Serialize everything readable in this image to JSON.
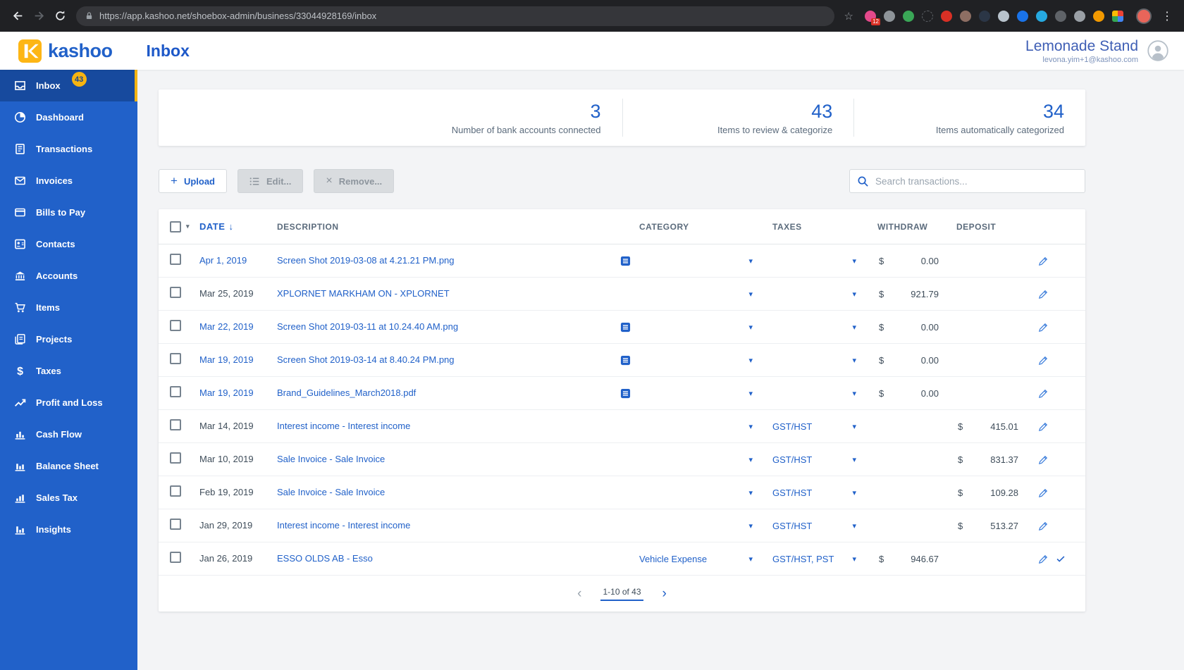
{
  "browser": {
    "url": "https://app.kashoo.net/shoebox-admin/business/33044928169/inbox",
    "extensions": [
      {
        "name": "extension-icon",
        "color": "#e4498b",
        "badge": "12"
      },
      {
        "name": "camera-extension-icon",
        "color": "#8e9499"
      },
      {
        "name": "extension-icon",
        "color": "#3aa757"
      },
      {
        "name": "extension-icon",
        "color": "#5f6368",
        "hollow": true
      },
      {
        "name": "extension-icon",
        "color": "#d93025"
      },
      {
        "name": "extension-icon",
        "color": "#8d6e63"
      },
      {
        "name": "extension-icon",
        "color": "#2b3646"
      },
      {
        "name": "extension-icon",
        "color": "#b8c3cc"
      },
      {
        "name": "extension-icon",
        "color": "#1a73e8"
      },
      {
        "name": "extension-icon",
        "color": "#26a9e0"
      },
      {
        "name": "extension-icon",
        "color": "#5f6368"
      },
      {
        "name": "extension-icon",
        "color": "#9aa0a6"
      },
      {
        "name": "extension-icon",
        "color": "#f29900"
      },
      {
        "name": "google-apps-grid-icon",
        "grid": true
      }
    ]
  },
  "icons": {
    "star": "☆",
    "browser_menu": "⋮",
    "caret": "▾",
    "select_caret": "▾",
    "sort_desc": "↓",
    "plus": "+",
    "close": "×",
    "pager_prev": "‹",
    "pager_next": "›"
  },
  "colors": {
    "accent_blue": "#2161c9",
    "sidebar_blue": "#2161c9",
    "sidebar_active_blue": "#174a9e",
    "brand_yellow": "#f6b411",
    "text_dark": "#3f4d5a",
    "text_muted": "#5b6b7c"
  },
  "header": {
    "logo_text": "kashoo",
    "page_title": "Inbox",
    "business_name": "Lemonade Stand",
    "user_email": "levona.yim+1@kashoo.com"
  },
  "sidebar": {
    "items": [
      {
        "label": "Inbox",
        "icon": "inbox-icon",
        "badge": "43",
        "active": true
      },
      {
        "label": "Dashboard",
        "icon": "dashboard-icon"
      },
      {
        "label": "Transactions",
        "icon": "transactions-icon"
      },
      {
        "label": "Invoices",
        "icon": "invoices-icon"
      },
      {
        "label": "Bills to Pay",
        "icon": "bills-to-pay-icon"
      },
      {
        "label": "Contacts",
        "icon": "contacts-icon"
      },
      {
        "label": "Accounts",
        "icon": "accounts-icon"
      },
      {
        "label": "Items",
        "icon": "items-icon"
      },
      {
        "label": "Projects",
        "icon": "projects-icon"
      },
      {
        "label": "Taxes",
        "icon": "taxes-icon"
      },
      {
        "label": "Profit and Loss",
        "icon": "profit-and-loss-icon"
      },
      {
        "label": "Cash Flow",
        "icon": "cash-flow-icon"
      },
      {
        "label": "Balance Sheet",
        "icon": "balance-sheet-icon"
      },
      {
        "label": "Sales Tax",
        "icon": "sales-tax-icon"
      },
      {
        "label": "Insights",
        "icon": "insights-icon"
      }
    ]
  },
  "stats": [
    {
      "value": "3",
      "label": "Number of bank accounts connected"
    },
    {
      "value": "43",
      "label": "Items to review & categorize"
    },
    {
      "value": "34",
      "label": "Items automatically categorized"
    }
  ],
  "toolbar": {
    "upload_label": "Upload",
    "edit_label": "Edit...",
    "remove_label": "Remove...",
    "search_placeholder": "Search transactions..."
  },
  "table": {
    "columns": [
      {
        "label": "DATE",
        "sorted": "desc"
      },
      {
        "label": "DESCRIPTION"
      },
      {
        "label": "CATEGORY"
      },
      {
        "label": "TAXES"
      },
      {
        "label": "WITHDRAW"
      },
      {
        "label": "DEPOSIT"
      }
    ],
    "currency_symbol": "$",
    "rows": [
      {
        "date": "Apr 1, 2019",
        "unread": true,
        "description": "Screen Shot 2019-03-08 at 4.21.21 PM.png",
        "attachment": true,
        "category": "",
        "taxes": "",
        "withdraw": "0.00",
        "deposit": "",
        "confirmed": false
      },
      {
        "date": "Mar 25, 2019",
        "unread": false,
        "description": "XPLORNET MARKHAM ON - XPLORNET",
        "attachment": false,
        "category": "",
        "taxes": "",
        "withdraw": "921.79",
        "deposit": "",
        "confirmed": false
      },
      {
        "date": "Mar 22, 2019",
        "unread": true,
        "description": "Screen Shot 2019-03-11 at 10.24.40 AM.png",
        "attachment": true,
        "category": "",
        "taxes": "",
        "withdraw": "0.00",
        "deposit": "",
        "confirmed": false
      },
      {
        "date": "Mar 19, 2019",
        "unread": true,
        "description": "Screen Shot 2019-03-14 at 8.40.24 PM.png",
        "attachment": true,
        "category": "",
        "taxes": "",
        "withdraw": "0.00",
        "deposit": "",
        "confirmed": false
      },
      {
        "date": "Mar 19, 2019",
        "unread": true,
        "description": "Brand_Guidelines_March2018.pdf",
        "attachment": true,
        "category": "",
        "taxes": "",
        "withdraw": "0.00",
        "deposit": "",
        "confirmed": false
      },
      {
        "date": "Mar 14, 2019",
        "unread": false,
        "description": "Interest income - Interest income",
        "attachment": false,
        "category": "",
        "taxes": "GST/HST",
        "withdraw": "",
        "deposit": "415.01",
        "confirmed": false
      },
      {
        "date": "Mar 10, 2019",
        "unread": false,
        "description": "Sale Invoice - Sale Invoice",
        "attachment": false,
        "category": "",
        "taxes": "GST/HST",
        "withdraw": "",
        "deposit": "831.37",
        "confirmed": false
      },
      {
        "date": "Feb 19, 2019",
        "unread": false,
        "description": "Sale Invoice - Sale Invoice",
        "attachment": false,
        "category": "",
        "taxes": "GST/HST",
        "withdraw": "",
        "deposit": "109.28",
        "confirmed": false
      },
      {
        "date": "Jan 29, 2019",
        "unread": false,
        "description": "Interest income - Interest income",
        "attachment": false,
        "category": "",
        "taxes": "GST/HST",
        "withdraw": "",
        "deposit": "513.27",
        "confirmed": false
      },
      {
        "date": "Jan 26, 2019",
        "unread": false,
        "description": "ESSO OLDS AB - Esso",
        "attachment": false,
        "category": "Vehicle Expense",
        "taxes": "GST/HST, PST",
        "withdraw": "946.67",
        "deposit": "",
        "confirmed": true
      }
    ]
  },
  "pagination": {
    "range": "1-10 of 43"
  }
}
